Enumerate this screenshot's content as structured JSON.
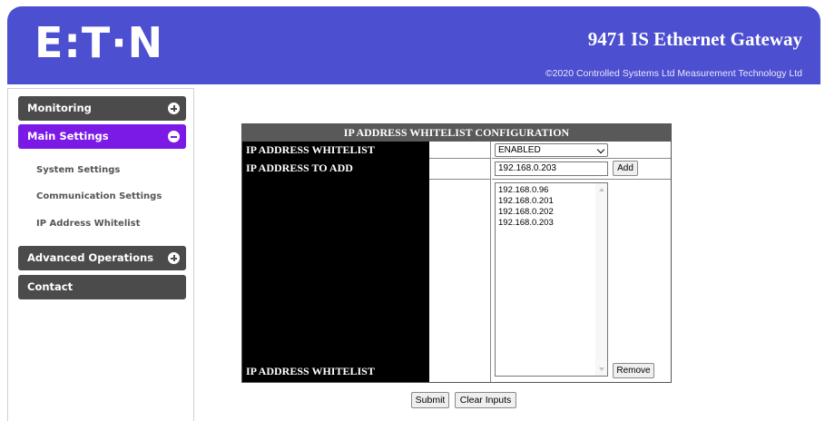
{
  "header": {
    "logo_text": "E:T·N",
    "title": "9471 IS Ethernet Gateway",
    "copyright": "©2020 Controlled Systems Ltd Measurement Technology Ltd"
  },
  "sidebar": {
    "menus": [
      {
        "label": "Monitoring",
        "icon": "plus-circle-icon",
        "expanded": false
      },
      {
        "label": "Main Settings",
        "icon": "minus-circle-icon",
        "expanded": true
      },
      {
        "label": "Advanced Operations",
        "icon": "plus-circle-icon",
        "expanded": false
      },
      {
        "label": "Contact"
      }
    ],
    "submenu": [
      "System Settings",
      "Communication Settings",
      "IP Address Whitelist"
    ]
  },
  "config": {
    "title": "IP ADDRESS WHITELIST CONFIGURATION",
    "whitelist_label": "IP ADDRESS WHITELIST",
    "whitelist_value": "ENABLED",
    "add_label": "IP ADDRESS TO ADD",
    "add_value": "192.168.0.203",
    "add_button": "Add",
    "list_label": "IP ADDRESS WHITELIST",
    "list_entries": [
      "192.168.0.96",
      "192.168.0.201",
      "192.168.0.202",
      "192.168.0.203"
    ],
    "remove_button": "Remove"
  },
  "actions": {
    "submit": "Submit",
    "clear": "Clear Inputs"
  },
  "colors": {
    "header_bg": "#4c4fcf",
    "menu_bg": "#4b4b4b",
    "menu_active_bg": "#7b19e6"
  }
}
